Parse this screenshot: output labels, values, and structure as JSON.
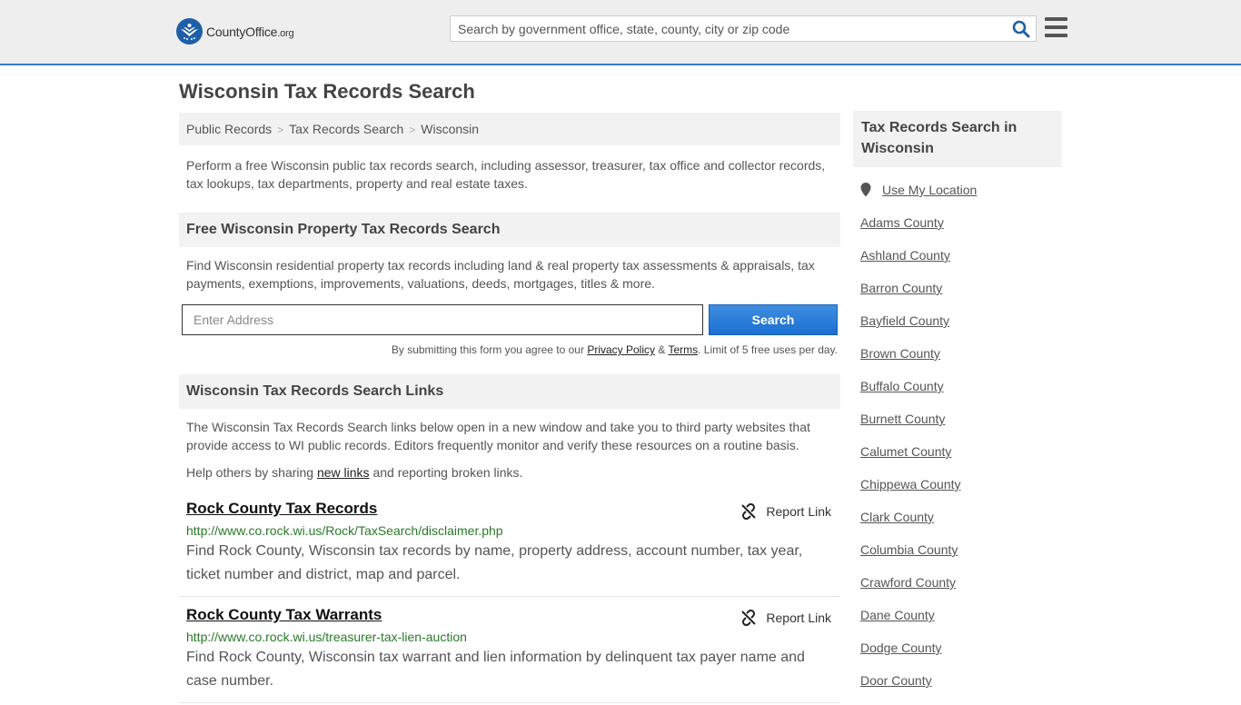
{
  "header": {
    "logo_brand": "CountyOffice",
    "logo_tld": ".org",
    "search_placeholder": "Search by government office, state, county, city or zip code"
  },
  "page_title": "Wisconsin Tax Records Search",
  "breadcrumb": [
    "Public Records",
    "Tax Records Search",
    "Wisconsin"
  ],
  "intro": "Perform a free Wisconsin public tax records search, including assessor, treasurer, tax office and collector records, tax lookups, tax departments, property and real estate taxes.",
  "property_search": {
    "heading": "Free Wisconsin Property Tax Records Search",
    "text": "Find Wisconsin residential property tax records including land & real property tax assessments & appraisals, tax payments, exemptions, improvements, valuations, deeds, mortgages, titles & more.",
    "address_placeholder": "Enter Address",
    "button": "Search",
    "disclaimer_pre": "By submitting this form you agree to our ",
    "privacy": "Privacy Policy",
    "amp": " & ",
    "terms": "Terms",
    "disclaimer_post": ". Limit of 5 free uses per day."
  },
  "links_section": {
    "heading": "Wisconsin Tax Records Search Links",
    "text": "The Wisconsin Tax Records Search links below open in a new window and take you to third party websites that provide access to WI public records. Editors frequently monitor and verify these resources on a routine basis.",
    "help_pre": "Help others by sharing ",
    "help_link": "new links",
    "help_post": " and reporting broken links.",
    "report_label": "Report Link",
    "items": [
      {
        "title": "Rock County Tax Records",
        "url": "http://www.co.rock.wi.us/Rock/TaxSearch/disclaimer.php",
        "desc": "Find Rock County, Wisconsin tax records by name, property address, account number, tax year, ticket number and district, map and parcel."
      },
      {
        "title": "Rock County Tax Warrants",
        "url": "http://www.co.rock.wi.us/treasurer-tax-lien-auction",
        "desc": "Find Rock County, Wisconsin tax warrant and lien information by delinquent tax payer name and case number."
      }
    ]
  },
  "sidebar": {
    "heading": "Tax Records Search in Wisconsin",
    "use_location": "Use My Location",
    "counties": [
      "Adams County",
      "Ashland County",
      "Barron County",
      "Bayfield County",
      "Brown County",
      "Buffalo County",
      "Burnett County",
      "Calumet County",
      "Chippewa County",
      "Clark County",
      "Columbia County",
      "Crawford County",
      "Dane County",
      "Dodge County",
      "Door County"
    ]
  }
}
